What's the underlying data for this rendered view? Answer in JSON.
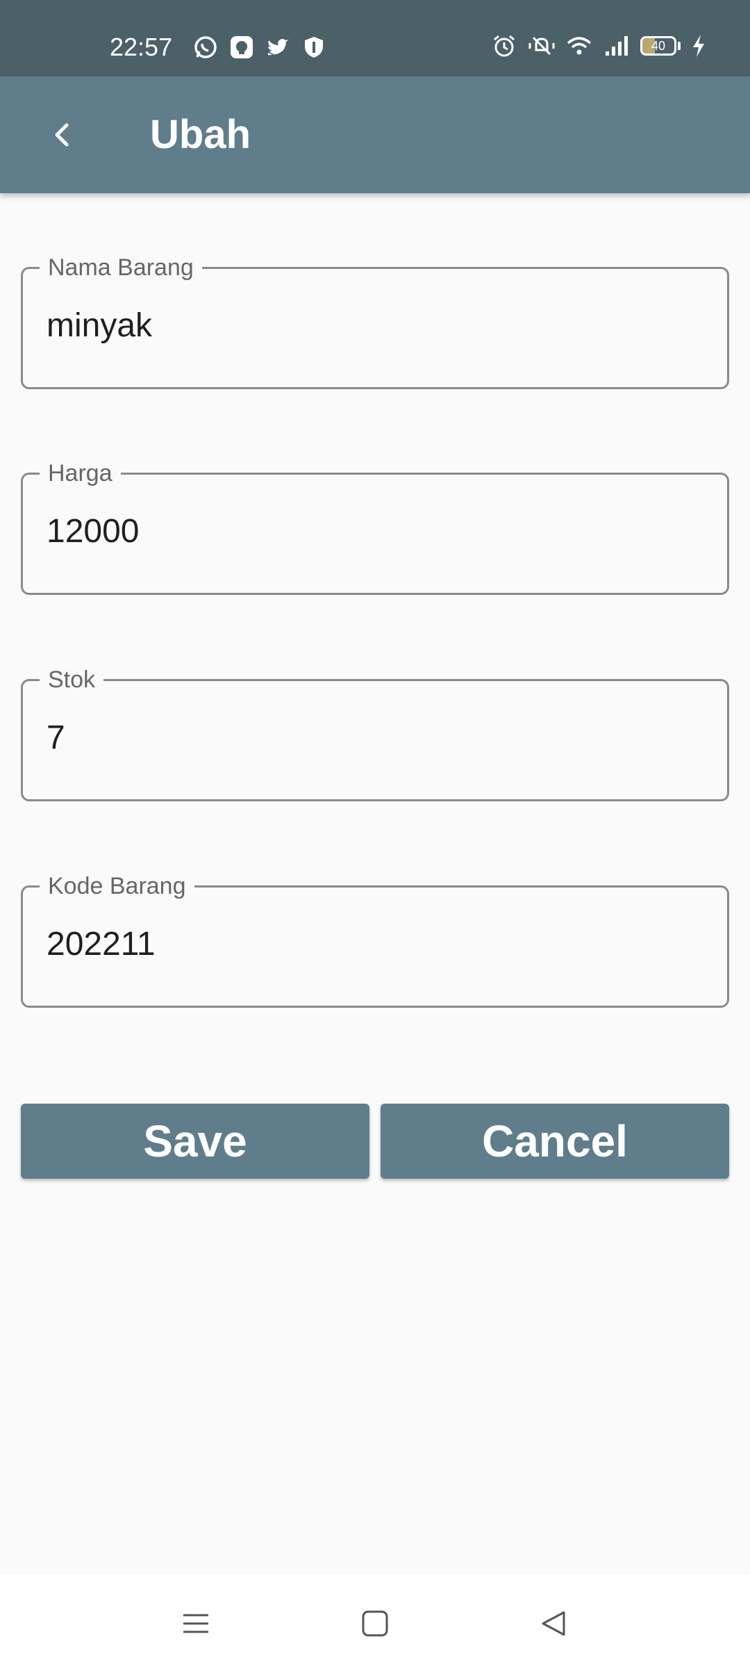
{
  "status_bar": {
    "time": "22:57",
    "left_icons": [
      "whatsapp-icon",
      "app-icon",
      "twitter-icon",
      "shield-icon"
    ],
    "right_icons": [
      "alarm-icon",
      "vibrate-icon",
      "wifi-icon",
      "signal-icon"
    ],
    "battery_level": "40"
  },
  "app_bar": {
    "title": "Ubah",
    "back_icon": "chevron-left-icon"
  },
  "form": {
    "nama_barang": {
      "label": "Nama Barang",
      "value": "minyak"
    },
    "harga": {
      "label": "Harga",
      "value": "12000"
    },
    "stok": {
      "label": "Stok",
      "value": "7"
    },
    "kode_barang": {
      "label": "Kode Barang",
      "value": "202211"
    }
  },
  "buttons": {
    "save_label": "Save",
    "cancel_label": "Cancel"
  },
  "colors": {
    "status_bar": "#4b6069",
    "app_bar": "#607d8b",
    "button": "#607d8b",
    "background": "#fafafa"
  },
  "nav_bar": {
    "icons": [
      "menu-icon",
      "home-icon",
      "back-triangle-icon"
    ]
  }
}
